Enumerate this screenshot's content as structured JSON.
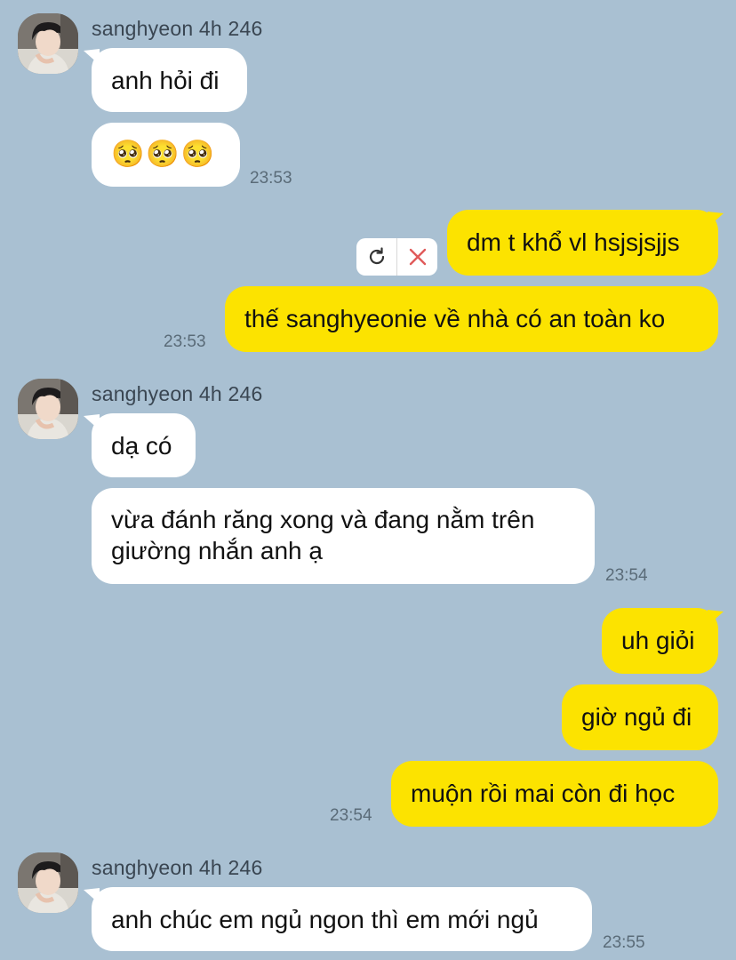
{
  "contact": {
    "name": "sanghyeon 4h 246"
  },
  "groups": [
    {
      "sender": "sanghyeon 4h 246",
      "messages": [
        "anh hỏi đi",
        "🥺🥺🥺"
      ],
      "time": "23:53"
    },
    {
      "sender": "me",
      "messages": [
        "dm t khổ vl hsjsjsjjs",
        "thế sanghyeonie về nhà có an toàn ko"
      ],
      "time": "23:53"
    },
    {
      "sender": "sanghyeon 4h 246",
      "messages": [
        "dạ có",
        "vừa đánh răng xong và đang nằm trên giường nhắn anh ạ"
      ],
      "time": "23:54"
    },
    {
      "sender": "me",
      "messages": [
        "uh giỏi",
        "giờ ngủ đi",
        "muộn rồi mai còn đi học"
      ],
      "time": "23:54"
    },
    {
      "sender": "sanghyeon 4h 246",
      "messages": [
        "anh chúc em ngủ ngon thì em mới ngủ"
      ],
      "time": "23:55"
    }
  ],
  "failed_actions": {
    "retry_icon": "refresh-icon",
    "delete_icon": "close-icon"
  },
  "colors": {
    "background": "#a9c0d2",
    "incoming_bubble": "#ffffff",
    "outgoing_bubble": "#fce300",
    "delete_x": "#e05a5a"
  }
}
